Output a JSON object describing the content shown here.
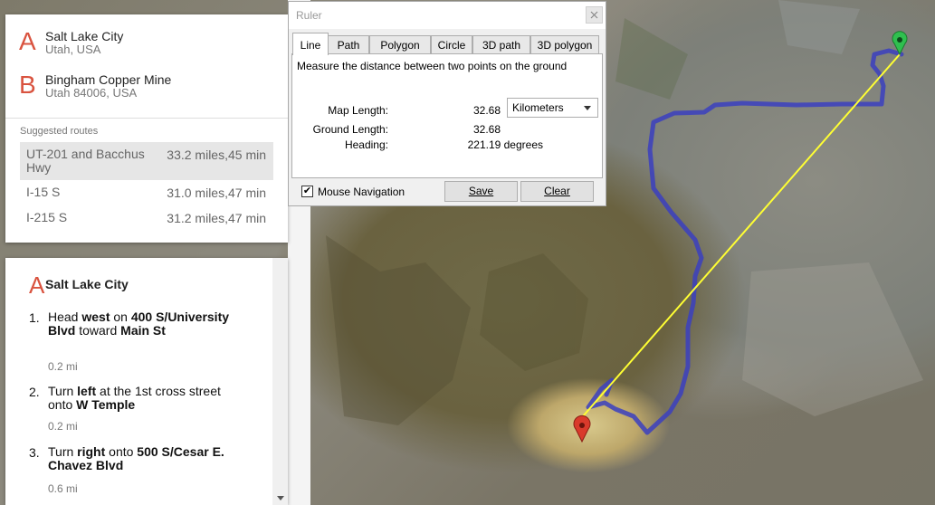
{
  "waypoints": [
    {
      "letter": "A",
      "name": "Salt Lake City",
      "sub": "Utah, USA"
    },
    {
      "letter": "B",
      "name": "Bingham Copper Mine",
      "sub": "Utah 84006, USA"
    }
  ],
  "routes": {
    "title": "Suggested routes",
    "items": [
      {
        "name": "UT-201 and Bacchus Hwy",
        "dist": "33.2 miles,45 min",
        "selected": true
      },
      {
        "name": "I-15 S",
        "dist": "31.0 miles,47 min",
        "selected": false
      },
      {
        "name": "I-215 S",
        "dist": "31.2 miles,47 min",
        "selected": false
      }
    ]
  },
  "directions": {
    "letter": "A",
    "start": "Salt Lake City",
    "steps": [
      {
        "num": "1.",
        "parts": [
          [
            "Head ",
            false
          ],
          [
            "west",
            true
          ],
          [
            " on ",
            false
          ],
          [
            "400 S/University Blvd",
            true
          ],
          [
            " toward ",
            false
          ],
          [
            "Main St",
            true
          ]
        ],
        "dist": "0.2 mi"
      },
      {
        "num": "2.",
        "parts": [
          [
            "Turn ",
            false
          ],
          [
            "left",
            true
          ],
          [
            " at the 1st cross street onto ",
            false
          ],
          [
            "W Temple",
            true
          ]
        ],
        "dist": "0.2 mi"
      },
      {
        "num": "3.",
        "parts": [
          [
            "Turn ",
            false
          ],
          [
            "right",
            true
          ],
          [
            " onto ",
            false
          ],
          [
            "500 S/Cesar E. Chavez Blvd",
            true
          ]
        ],
        "dist": "0.6 mi"
      }
    ]
  },
  "ruler": {
    "title": "Ruler",
    "tabs": [
      "Line",
      "Path",
      "Polygon",
      "Circle",
      "3D path",
      "3D polygon"
    ],
    "active_tab": 0,
    "description": "Measure the distance between two points on the ground",
    "map_length_label": "Map Length:",
    "map_length": "32.68",
    "unit": "Kilometers",
    "ground_length_label": "Ground Length:",
    "ground_length": "32.68",
    "heading_label": "Heading:",
    "heading": "221.19 degrees",
    "mouse_nav_label": "Mouse Navigation",
    "mouse_nav_checked": true,
    "save_label": "Save",
    "clear_label": "Clear"
  },
  "colors": {
    "accent_red": "#d9533f",
    "route_line": "#3b3fbf",
    "ruler_line": "#ffff33",
    "start_pin": "#2fbf4f",
    "end_pin": "#d93a2b"
  },
  "icons": {
    "start_marker": "green-pin-icon",
    "end_marker": "red-pin-icon",
    "close": "close-icon",
    "dropdown": "chevron-down-icon",
    "scroll_down": "scroll-down-arrow-icon"
  }
}
